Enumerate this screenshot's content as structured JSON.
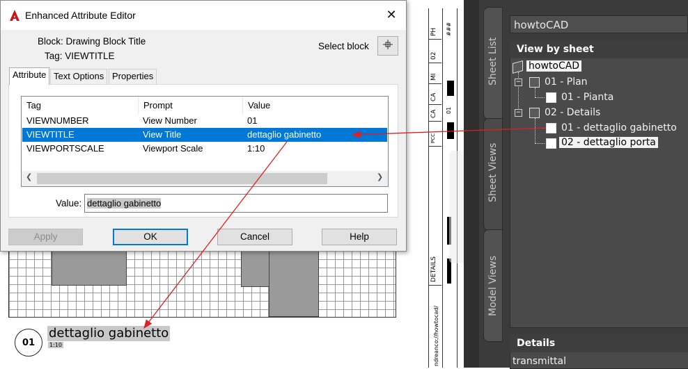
{
  "dialog": {
    "title": "Enhanced Attribute Editor",
    "block_label": "Block: Drawing Block Title",
    "tag_label": "Tag: VIEWTITLE",
    "select_block_label": "Select block",
    "tabs": [
      {
        "label": "Attribute",
        "active": true
      },
      {
        "label": "Text Options",
        "active": false
      },
      {
        "label": "Properties",
        "active": false
      }
    ],
    "columns": [
      "Tag",
      "Prompt",
      "Value"
    ],
    "rows": [
      {
        "tag": "VIEWNUMBER",
        "prompt": "View Number",
        "value": "01",
        "selected": false
      },
      {
        "tag": "VIEWTITLE",
        "prompt": "View Title",
        "value": "dettaglio gabinetto",
        "selected": true
      },
      {
        "tag": "VIEWPORTSCALE",
        "prompt": "Viewport Scale",
        "value": "1:10",
        "selected": false
      }
    ],
    "value_label": "Value:",
    "value_input": "dettaglio gabinetto",
    "buttons": {
      "apply": "Apply",
      "ok": "OK",
      "cancel": "Cancel",
      "help": "Help"
    }
  },
  "drawing": {
    "view_number": "01",
    "view_title": "dettaglio gabinetto",
    "view_scale": "1:10",
    "title_strip": {
      "labels": [
        "PH",
        "###",
        "02",
        "MI",
        "CA",
        "CA",
        "01",
        "PCC",
        "DETAILS"
      ],
      "url": "ndreanco://howtocad/"
    }
  },
  "sheet_set_manager": {
    "combo_value": "howtoCAD",
    "side_tabs": [
      "Sheet List",
      "Sheet Views",
      "Model Views"
    ],
    "active_tab": "Sheet Views",
    "tree_header": "View by sheet",
    "tree": {
      "root": "howtoCAD",
      "sheets": [
        {
          "label": "01 - Plan",
          "views": [
            "01 - Pianta"
          ]
        },
        {
          "label": "02 - Details",
          "views": [
            "01 - dettaglio gabinetto",
            "02 - dettaglio porta"
          ]
        }
      ],
      "selected_view": "02 - dettaglio porta"
    },
    "details_header": "Details",
    "details_value": "transmittal"
  },
  "colors": {
    "accent": "#0078d7",
    "arrow": "#e02020",
    "ssm_bg": "#3b3b3b",
    "autocad_red": "#c4161c"
  },
  "icons": {
    "app": "autocad-logo-icon",
    "close": "close-icon",
    "select_block": "crosshair-pick-icon",
    "sheet": "sheet-icon",
    "view": "view-icon",
    "sheet_set": "sheet-set-icon"
  }
}
